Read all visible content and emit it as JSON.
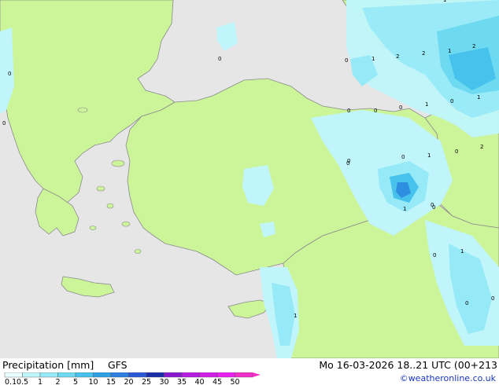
{
  "legend": {
    "title": "Precipitation [mm]",
    "model": "GFS",
    "datetime": "Mo 16-03-2026 18..21 UTC (00+213",
    "credit": "©weatheronline.co.uk",
    "scale_labels": [
      "0.1",
      "0.5",
      "1",
      "2",
      "5",
      "10",
      "15",
      "20",
      "25",
      "30",
      "35",
      "40",
      "45",
      "50"
    ],
    "scale_colors": [
      "#eaffff",
      "#bff5fb",
      "#96eaf7",
      "#6edaf2",
      "#46c2ec",
      "#2ea0e6",
      "#2c7ee0",
      "#2a58d6",
      "#1a2ea8",
      "#8a1ad0",
      "#b41ce0",
      "#d01ee8",
      "#e820f0",
      "#f030c8"
    ]
  },
  "map": {
    "colors": {
      "sea": "#e6e6e6",
      "land": "#ccf59a",
      "border": "#8a8a8a"
    },
    "grid_values": [
      "0",
      "1",
      "2",
      "2",
      "1",
      "2",
      "0",
      "1",
      "0",
      "1",
      "0",
      "0",
      "0",
      "2",
      "0",
      "0",
      "1",
      "0",
      "1",
      "1",
      "0",
      "0",
      "0",
      "0",
      "0",
      "1",
      "0",
      "1",
      "0",
      "0"
    ]
  }
}
